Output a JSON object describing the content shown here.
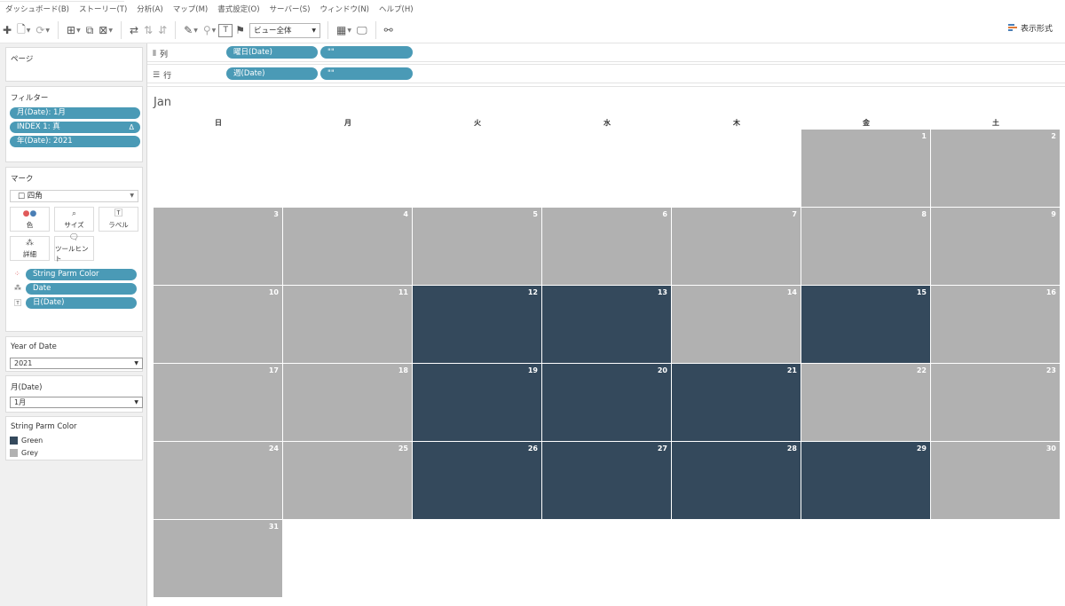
{
  "menu": [
    "ダッシュボード(B)",
    "ストーリー(T)",
    "分析(A)",
    "マップ(M)",
    "書式設定(O)",
    "サーバー(S)",
    "ウィンドウ(N)",
    "ヘルプ(H)"
  ],
  "toolbar": {
    "fit_select": "ビュー全体",
    "show_me": "表示形式"
  },
  "pages_card": {
    "title": "ページ"
  },
  "filters_card": {
    "title": "フィルター",
    "pills": [
      {
        "label": "月(Date): 1月"
      },
      {
        "label": "INDEX 1: 真",
        "badge": "Δ"
      },
      {
        "label": "年(Date): 2021"
      }
    ]
  },
  "marks_card": {
    "title": "マーク",
    "mark_type": "□ 四角",
    "buttons": [
      {
        "label": "色",
        "icon": "color-dots-icon"
      },
      {
        "label": "サイズ",
        "icon": "size-icon"
      },
      {
        "label": "ラベル",
        "icon": "label-T-icon"
      },
      {
        "label": "詳細",
        "icon": "detail-dots-icon"
      },
      {
        "label": "ツールヒント",
        "icon": "tooltip-icon"
      }
    ],
    "fields": [
      {
        "label": "String Parm Color",
        "icon": "color-dots-icon"
      },
      {
        "label": "Date",
        "icon": "detail-dots-icon"
      },
      {
        "label": "日(Date)",
        "icon": "label-T-icon"
      }
    ]
  },
  "quick_filters": [
    {
      "title": "Year of Date",
      "value": "2021"
    },
    {
      "title": "月(Date)",
      "value": "1月"
    }
  ],
  "color_legend": {
    "title": "String Parm Color",
    "items": [
      {
        "label": "Green",
        "color": "#34495c"
      },
      {
        "label": "Grey",
        "color": "#b1b1b1"
      }
    ]
  },
  "columns_shelf": {
    "label": "列",
    "pills": [
      "曜日(Date)",
      "\"\""
    ]
  },
  "rows_shelf": {
    "label": "行",
    "pills": [
      "週(Date)",
      "\"\""
    ]
  },
  "calendar": {
    "month": "Jan",
    "weekdays": [
      "日",
      "月",
      "火",
      "水",
      "木",
      "金",
      "土"
    ],
    "colors": {
      "Green": "#34495c",
      "Grey": "#b1b1b1"
    },
    "days": [
      {
        "day": 1,
        "week": 0,
        "dow": 5,
        "color": "Grey"
      },
      {
        "day": 2,
        "week": 0,
        "dow": 6,
        "color": "Grey"
      },
      {
        "day": 3,
        "week": 1,
        "dow": 0,
        "color": "Grey"
      },
      {
        "day": 4,
        "week": 1,
        "dow": 1,
        "color": "Grey"
      },
      {
        "day": 5,
        "week": 1,
        "dow": 2,
        "color": "Grey"
      },
      {
        "day": 6,
        "week": 1,
        "dow": 3,
        "color": "Grey"
      },
      {
        "day": 7,
        "week": 1,
        "dow": 4,
        "color": "Grey"
      },
      {
        "day": 8,
        "week": 1,
        "dow": 5,
        "color": "Grey"
      },
      {
        "day": 9,
        "week": 1,
        "dow": 6,
        "color": "Grey"
      },
      {
        "day": 10,
        "week": 2,
        "dow": 0,
        "color": "Grey"
      },
      {
        "day": 11,
        "week": 2,
        "dow": 1,
        "color": "Grey"
      },
      {
        "day": 12,
        "week": 2,
        "dow": 2,
        "color": "Green"
      },
      {
        "day": 13,
        "week": 2,
        "dow": 3,
        "color": "Green"
      },
      {
        "day": 14,
        "week": 2,
        "dow": 4,
        "color": "Grey"
      },
      {
        "day": 15,
        "week": 2,
        "dow": 5,
        "color": "Green"
      },
      {
        "day": 16,
        "week": 2,
        "dow": 6,
        "color": "Grey"
      },
      {
        "day": 17,
        "week": 3,
        "dow": 0,
        "color": "Grey"
      },
      {
        "day": 18,
        "week": 3,
        "dow": 1,
        "color": "Grey"
      },
      {
        "day": 19,
        "week": 3,
        "dow": 2,
        "color": "Green"
      },
      {
        "day": 20,
        "week": 3,
        "dow": 3,
        "color": "Green"
      },
      {
        "day": 21,
        "week": 3,
        "dow": 4,
        "color": "Green"
      },
      {
        "day": 22,
        "week": 3,
        "dow": 5,
        "color": "Grey"
      },
      {
        "day": 23,
        "week": 3,
        "dow": 6,
        "color": "Grey"
      },
      {
        "day": 24,
        "week": 4,
        "dow": 0,
        "color": "Grey"
      },
      {
        "day": 25,
        "week": 4,
        "dow": 1,
        "color": "Grey"
      },
      {
        "day": 26,
        "week": 4,
        "dow": 2,
        "color": "Green"
      },
      {
        "day": 27,
        "week": 4,
        "dow": 3,
        "color": "Green"
      },
      {
        "day": 28,
        "week": 4,
        "dow": 4,
        "color": "Green"
      },
      {
        "day": 29,
        "week": 4,
        "dow": 5,
        "color": "Green"
      },
      {
        "day": 30,
        "week": 4,
        "dow": 6,
        "color": "Grey"
      },
      {
        "day": 31,
        "week": 5,
        "dow": 0,
        "color": "Grey"
      }
    ]
  }
}
